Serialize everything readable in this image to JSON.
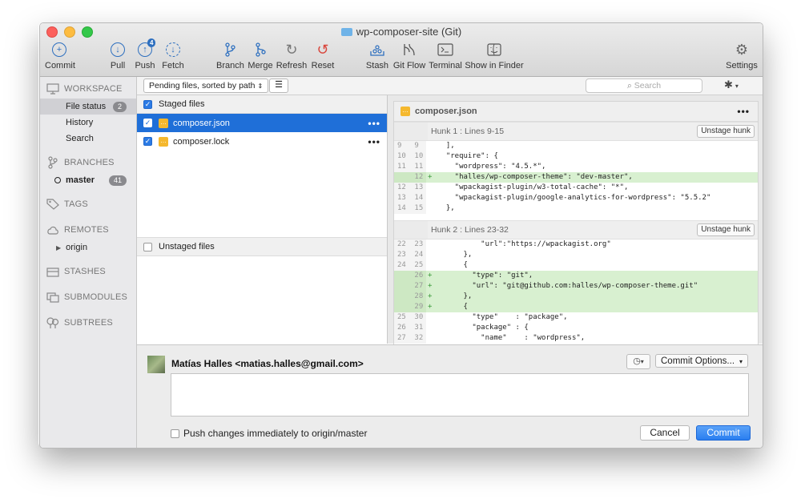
{
  "window": {
    "title": "wp-composer-site (Git)"
  },
  "toolbar": {
    "commit": "Commit",
    "pull": "Pull",
    "push": "Push",
    "push_badge": "4",
    "fetch": "Fetch",
    "branch": "Branch",
    "merge": "Merge",
    "refresh": "Refresh",
    "reset": "Reset",
    "stash": "Stash",
    "gitflow": "Git Flow",
    "terminal": "Terminal",
    "show_in_finder": "Show in Finder",
    "settings": "Settings"
  },
  "sidebar": {
    "workspace": "WORKSPACE",
    "file_status": "File status",
    "file_status_count": "2",
    "history": "History",
    "search": "Search",
    "branches": "BRANCHES",
    "master": "master",
    "master_count": "41",
    "tags": "TAGS",
    "remotes": "REMOTES",
    "origin": "origin",
    "stashes": "STASHES",
    "submodules": "SUBMODULES",
    "subtrees": "SUBTREES"
  },
  "filter": {
    "sort": "Pending files, sorted by path",
    "search_placeholder": "Search"
  },
  "files": {
    "staged_header": "Staged files",
    "staged": [
      {
        "name": "composer.json",
        "selected": true
      },
      {
        "name": "composer.lock",
        "selected": false
      }
    ],
    "unstaged_header": "Unstaged files"
  },
  "diff": {
    "file": "composer.json",
    "hunks": [
      {
        "title": "Hunk 1 : Lines 9-15",
        "button": "Unstage hunk",
        "lines": [
          {
            "old": "9",
            "new": "9",
            "sign": "",
            "text": "  ],",
            "type": "ctx"
          },
          {
            "old": "10",
            "new": "10",
            "sign": "",
            "text": "  \"require\": {",
            "type": "ctx"
          },
          {
            "old": "11",
            "new": "11",
            "sign": "",
            "text": "    \"wordpress\": \"4.5.*\",",
            "type": "ctx"
          },
          {
            "old": "",
            "new": "12",
            "sign": "+",
            "text": "    \"halles/wp-composer-theme\": \"dev-master\",",
            "type": "add"
          },
          {
            "old": "12",
            "new": "13",
            "sign": "",
            "text": "    \"wpackagist-plugin/w3-total-cache\": \"*\",",
            "type": "ctx"
          },
          {
            "old": "13",
            "new": "14",
            "sign": "",
            "text": "    \"wpackagist-plugin/google-analytics-for-wordpress\": \"5.5.2\"",
            "type": "ctx"
          },
          {
            "old": "14",
            "new": "15",
            "sign": "",
            "text": "  },",
            "type": "ctx"
          }
        ]
      },
      {
        "title": "Hunk 2 : Lines 23-32",
        "button": "Unstage hunk",
        "lines": [
          {
            "old": "22",
            "new": "23",
            "sign": "",
            "text": "          \"url\":\"https://wpackagist.org\"",
            "type": "ctx"
          },
          {
            "old": "23",
            "new": "24",
            "sign": "",
            "text": "      },",
            "type": "ctx"
          },
          {
            "old": "24",
            "new": "25",
            "sign": "",
            "text": "      {",
            "type": "ctx"
          },
          {
            "old": "",
            "new": "26",
            "sign": "+",
            "text": "        \"type\": \"git\",",
            "type": "add"
          },
          {
            "old": "",
            "new": "27",
            "sign": "+",
            "text": "        \"url\": \"git@github.com:halles/wp-composer-theme.git\"",
            "type": "add"
          },
          {
            "old": "",
            "new": "28",
            "sign": "+",
            "text": "      },",
            "type": "add"
          },
          {
            "old": "",
            "new": "29",
            "sign": "+",
            "text": "      {",
            "type": "add"
          },
          {
            "old": "25",
            "new": "30",
            "sign": "",
            "text": "        \"type\"    : \"package\",",
            "type": "ctx"
          },
          {
            "old": "26",
            "new": "31",
            "sign": "",
            "text": "        \"package\" : {",
            "type": "ctx"
          },
          {
            "old": "27",
            "new": "32",
            "sign": "",
            "text": "          \"name\"    : \"wordpress\",",
            "type": "ctx"
          }
        ]
      }
    ]
  },
  "commit": {
    "author": "Matías Halles <matias.halles@gmail.com>",
    "options": "Commit Options...",
    "push_label": "Push changes immediately to origin/master",
    "cancel": "Cancel",
    "commit": "Commit"
  }
}
